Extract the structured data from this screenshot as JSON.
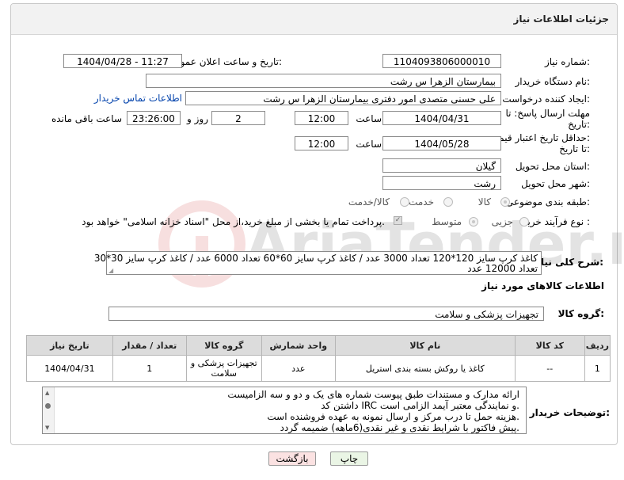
{
  "panel": {
    "title": "جزئیات اطلاعات نیاز"
  },
  "fields": {
    "need_number_label": "شماره نیاز:",
    "need_number": "1104093806000010",
    "announce_label": "تاریخ و ساعت اعلان عمومی:",
    "announce_value": "1404/04/28 - 11:27",
    "buyer_org_label": "نام دستگاه خریدار:",
    "buyer_org": "بیمارستان الزهرا  س  رشت",
    "creator_label": "ایجاد کننده درخواست:",
    "creator": "علی حسنی متصدی امور دفتری بیمارستان الزهرا  س  رشت",
    "contact_link": "اطلاعات تماس خریدار",
    "reply_label_1": "مهلت ارسال پاسخ: تا",
    "reply_label_2": "تاریخ:",
    "reply_date": "1404/04/31",
    "time_label": "ساعت",
    "reply_time": "12:00",
    "days_value": "2",
    "days_label": "روز و",
    "remaining_time": "23:26:00",
    "remaining_label": "ساعت باقی مانده",
    "validity_label_1": "حداقل تاریخ اعتبار قیمت:",
    "validity_label_2": "تا تاریخ:",
    "validity_date": "1404/05/28",
    "validity_time": "12:00",
    "province_label": "استان محل تحویل:",
    "province": "گیلان",
    "city_label": "شهر محل تحویل:",
    "city": "رشت",
    "category_label": "طبقه بندی موضوعی:",
    "category_options": [
      "کالا",
      "خدمت",
      "کالا/خدمت"
    ],
    "process_label": "نوع فرآیند خرید :",
    "process_options": [
      "جزیی",
      "متوسط"
    ],
    "payment_note": "پرداخت تمام یا بخشی از مبلغ خرید،از محل \"اسناد خزانه اسلامی\" خواهد بود.",
    "desc_label": "شرح کلی نیاز:",
    "desc_line1": "کاغذ کرپ سایز 120*120 تعداد 3000 عدد /  کاغذ کرپ سایز 60*60 تعداد 6000 عدد  / کاغذ کرپ سایز 30*30",
    "desc_line2": "تعداد 12000 عدد",
    "goods_info_title": "اطلاعات کالاهای مورد نیاز",
    "goods_group_label": "گروه کالا:",
    "goods_group": "تجهیزات پزشکی و سلامت"
  },
  "table": {
    "headers": [
      "ردیف",
      "کد کالا",
      "نام کالا",
      "واحد شمارش",
      "گروه کالا",
      "تعداد / مقدار",
      "تاریخ نیاز"
    ],
    "rows": [
      {
        "row": "1",
        "code": "--",
        "name": "کاغذ یا روکش بسته بندی استریل",
        "unit": "عدد",
        "group": "تجهیزات پزشکی و سلامت",
        "qty": "1",
        "date": "1404/04/31"
      }
    ]
  },
  "notes": {
    "label": "توضیحات خریدار:",
    "lines": [
      "ارائه مدارک و مستندات طبق پیوست شماره های یک و دو و سه الزامیست",
      "داشتن کد IRC و نمایندگی معتبر آیمد الزامی است.",
      "هزینه حمل تا درب مرکز و ارسال نمونه به عهده فروشنده است.",
      "پیش فاکتور با شرایط نقدی و غیر نقدی(6ماهه) ضمیمه گردد."
    ]
  },
  "buttons": {
    "print": "چاپ",
    "back": "بازگشت"
  },
  "colors": {
    "back_bg": "#fbe2e2",
    "print_bg": "#eaf5e5",
    "link": "#0645ad"
  },
  "watermark": {
    "text": "AriaTender.neT"
  }
}
